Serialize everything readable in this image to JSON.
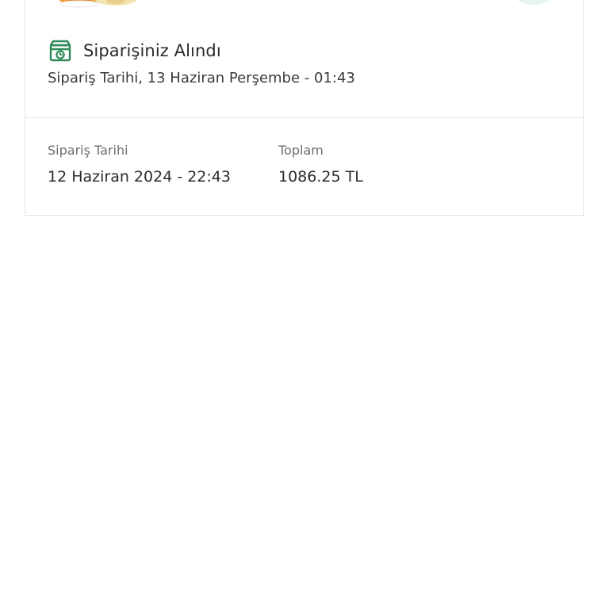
{
  "order": {
    "status_title": "Siparişiniz Alındı",
    "status_subtitle": "Sipariş Tarihi, 13 Haziran Perşembe - 01:43",
    "details": {
      "date_label": "Sipariş Tarihi",
      "date_value": "12 Haziran 2024 - 22:43",
      "total_label": "Toplam",
      "total_value": "1086.25 TL"
    }
  },
  "icons": {
    "status_icon": "package-box-icon",
    "thumbnail": "food-thumbnail"
  },
  "colors": {
    "accent_green": "#2e8b57",
    "border": "#e3e3e3",
    "action_circle": "#e4f6ef"
  }
}
